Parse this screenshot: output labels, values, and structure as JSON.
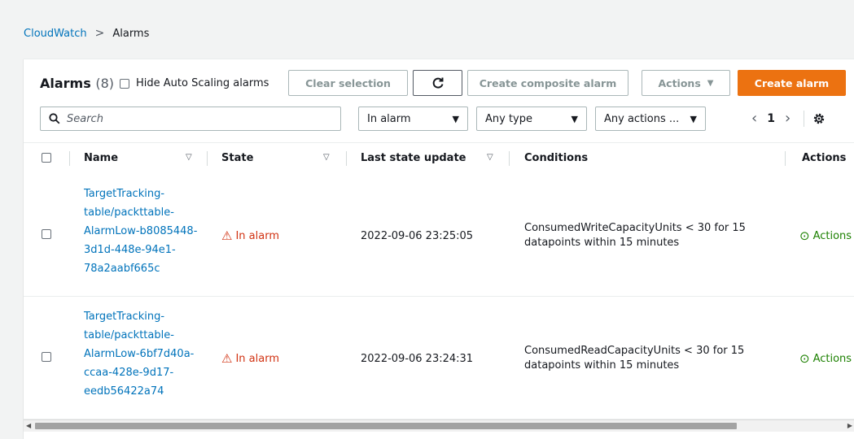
{
  "breadcrumb": {
    "root": "CloudWatch",
    "separator": ">",
    "current": "Alarms"
  },
  "header": {
    "title": "Alarms",
    "count": "(8)",
    "hide_autoscaling_label": "Hide Auto Scaling alarms"
  },
  "toolbar": {
    "clear_selection": "Clear selection",
    "refresh_icon": "refresh-icon",
    "create_composite": "Create composite alarm",
    "actions": "Actions",
    "create_alarm": "Create alarm"
  },
  "filters": {
    "search_placeholder": "Search",
    "state_filter": "In alarm",
    "type_filter": "Any type",
    "actions_filter": "Any actions ..."
  },
  "pagination": {
    "current_page": "1"
  },
  "table": {
    "columns": [
      "Name",
      "State",
      "Last state update",
      "Conditions",
      "Actions"
    ],
    "rows": [
      {
        "name": "TargetTracking-table/packttable-AlarmLow-b8085448-3d1d-448e-94e1-78a2aabf665c",
        "state": "In alarm",
        "last_update": "2022-09-06 23:25:05",
        "conditions": "ConsumedWriteCapacityUnits < 30 for 15 datapoints within 15 minutes",
        "actions": "Actions"
      },
      {
        "name": "TargetTracking-table/packttable-AlarmLow-6bf7d40a-ccaa-428e-9d17-eedb56422a74",
        "state": "In alarm",
        "last_update": "2022-09-06 23:24:31",
        "conditions": "ConsumedReadCapacityUnits < 30 for 15 datapoints within 15 minutes",
        "actions": "Actions"
      }
    ]
  },
  "colors": {
    "link": "#0073bb",
    "alarm": "#d13212",
    "ok": "#1d8102",
    "primary": "#ec7211"
  }
}
